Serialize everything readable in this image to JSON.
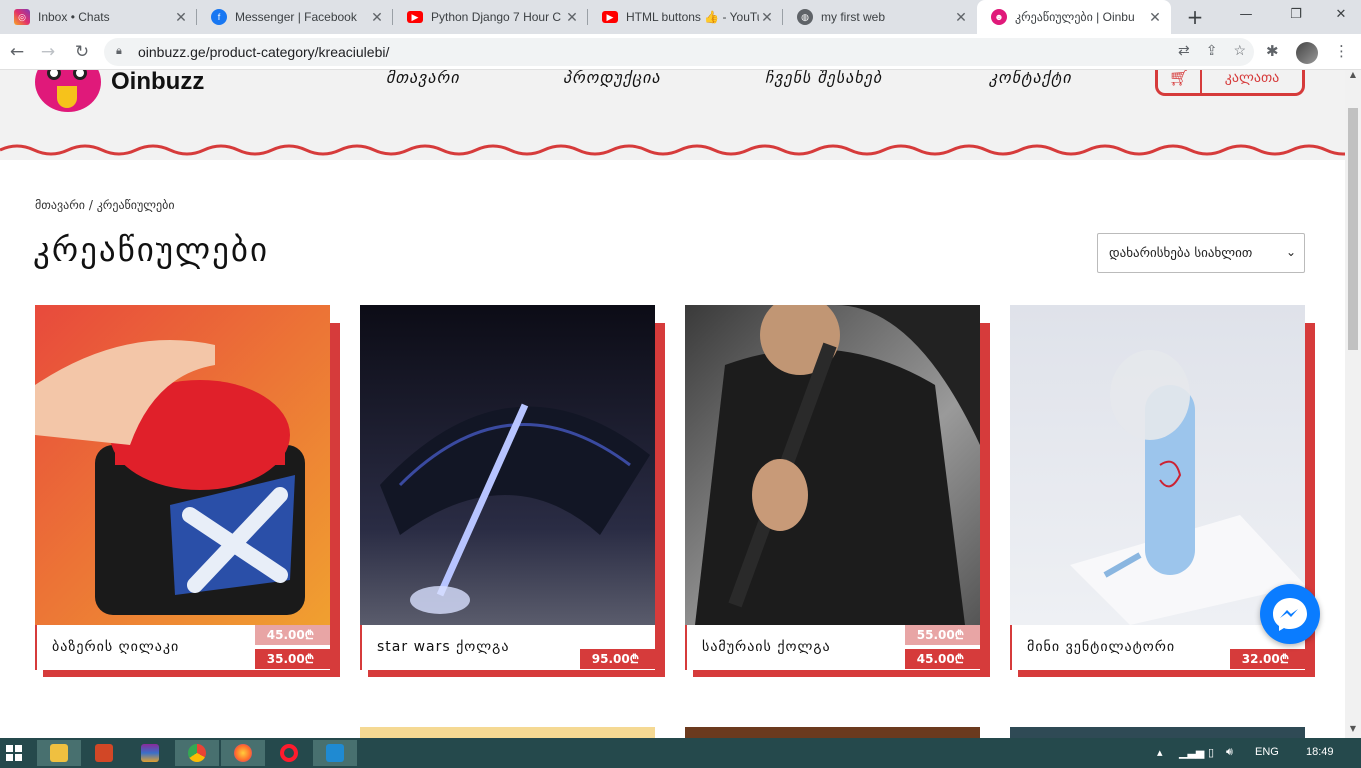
{
  "browser": {
    "tabs": [
      {
        "title": "Inbox • Chats",
        "icon": "instagram-icon"
      },
      {
        "title": "Messenger | Facebook",
        "icon": "facebook-icon"
      },
      {
        "title": "Python Django 7 Hour C",
        "icon": "youtube-icon"
      },
      {
        "title": "HTML buttons 👍 - YouTu",
        "icon": "youtube-icon"
      },
      {
        "title": "my first web",
        "icon": "globe-icon"
      },
      {
        "title": "კრეაწიულები | Oinbu",
        "icon": "oinbuzz-icon",
        "active": true
      }
    ],
    "url": "oinbuzz.ge/product-category/kreaciulebi/"
  },
  "site": {
    "logo": "Oinbuzz",
    "menu": [
      "მთავარი",
      "პროდუქცია",
      "ჩვენს შესახებ",
      "კონტაქტი"
    ],
    "cart_label": "კალათა"
  },
  "breadcrumb": {
    "home": "მთავარი",
    "sep": "/",
    "current": "კრეაწიულები"
  },
  "page_title": "კრეაწიულები",
  "sort": {
    "selected": "დახარისხება სიახლით"
  },
  "products": [
    {
      "name": "ბაზერის ღილაკი",
      "old_price": "45.00₾",
      "price": "35.00₾"
    },
    {
      "name": "star wars ქოლგა",
      "old_price": "",
      "price": "95.00₾"
    },
    {
      "name": "სამურაის ქოლგა",
      "old_price": "55.00₾",
      "price": "45.00₾"
    },
    {
      "name": "მინი ვენტილატორი",
      "old_price": "",
      "price": "32.00₾"
    }
  ],
  "taskbar": {
    "lang": "ENG",
    "time": "18:49"
  },
  "colors": {
    "accent": "#d63b3b",
    "header_bg": "#f2f2f2",
    "taskbar": "#25494c"
  }
}
